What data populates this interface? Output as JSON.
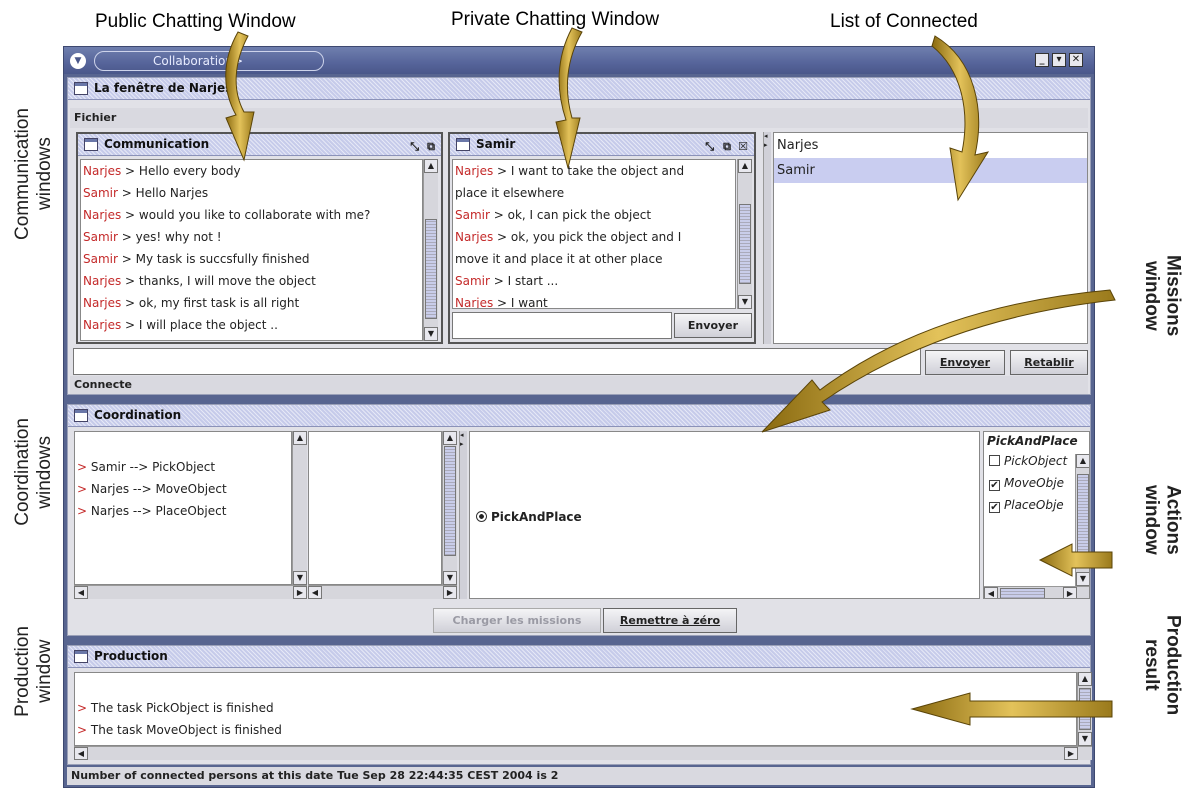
{
  "annotations": {
    "public_chat": "Public Chatting Window",
    "private_chat": "Private Chatting Window",
    "connected_list": "List of Connected",
    "communication": "Communication\nwindows",
    "coordination": "Coordination\nwindows",
    "production": "Production\nwindow",
    "missions": "Missions\nwindow",
    "actions": "Actions\nwindow",
    "production_result": "Production\nresult"
  },
  "window": {
    "title": "Collaboration",
    "title_suffix": ">",
    "inner_title": "La fenêtre de Narjes",
    "menu_file": "Fichier"
  },
  "communication": {
    "title": "Communication",
    "messages": [
      {
        "name": "Narjes",
        "text": " > Hello every body"
      },
      {
        "name": "Samir",
        "text": " > Hello Narjes"
      },
      {
        "name": "Narjes",
        "text": " > would you like to collaborate with me?"
      },
      {
        "name": "Samir",
        "text": " > yes! why not !"
      },
      {
        "name": "Samir",
        "text": " > My task is succsfully finished"
      },
      {
        "name": "Narjes",
        "text": " > thanks, I will move the object"
      },
      {
        "name": "Narjes",
        "text": " > ok, my first task is all right"
      },
      {
        "name": "Narjes",
        "text": " > I will place the object .."
      }
    ]
  },
  "private": {
    "title": "Samir",
    "lines": [
      {
        "name": "Narjes",
        "text": " > I want to take the object and"
      },
      {
        "name": "",
        "text": "place it elsewhere"
      },
      {
        "name": "Samir",
        "text": " > ok, I can pick the object"
      },
      {
        "name": "Narjes",
        "text": " > ok, you pick the object and I"
      },
      {
        "name": "",
        "text": "move it and place it at other place"
      },
      {
        "name": "Samir",
        "text": " > I start ..."
      },
      {
        "name": "Narjes",
        "text": " > I want"
      }
    ],
    "send_label": "Envoyer"
  },
  "connected": [
    "Narjes",
    "Samir"
  ],
  "global": {
    "send_label": "Envoyer",
    "reset_label": "Retablir",
    "status": "Connecte"
  },
  "coordination": {
    "title": "Coordination",
    "assignments": [
      {
        "prefix": ">",
        "text": " Samir --> PickObject"
      },
      {
        "prefix": ">",
        "text": " Narjes --> MoveObject"
      },
      {
        "prefix": ">",
        "text": " Narjes --> PlaceObject"
      }
    ],
    "mission_label": "PickAndPlace",
    "actions_title": "PickAndPlace",
    "actions": [
      {
        "label": "PickObject",
        "checked": false
      },
      {
        "label": "MoveObje",
        "checked": true
      },
      {
        "label": "PlaceObje",
        "checked": true
      }
    ],
    "load_label": "Charger les missions",
    "reset_label": "Remettre à zéro"
  },
  "production": {
    "title": "Production",
    "results": [
      {
        "prefix": ">",
        "text": " The task PickObject is finished"
      },
      {
        "prefix": ">",
        "text": " The task MoveObject is finished"
      }
    ],
    "status": "Number of connected persons at this date Tue Sep 28 22:44:35 CEST 2004 is  2"
  },
  "colors": {
    "name": "#c42a2a",
    "accent": "#c6cbea",
    "arrow": "#c9a13a"
  }
}
